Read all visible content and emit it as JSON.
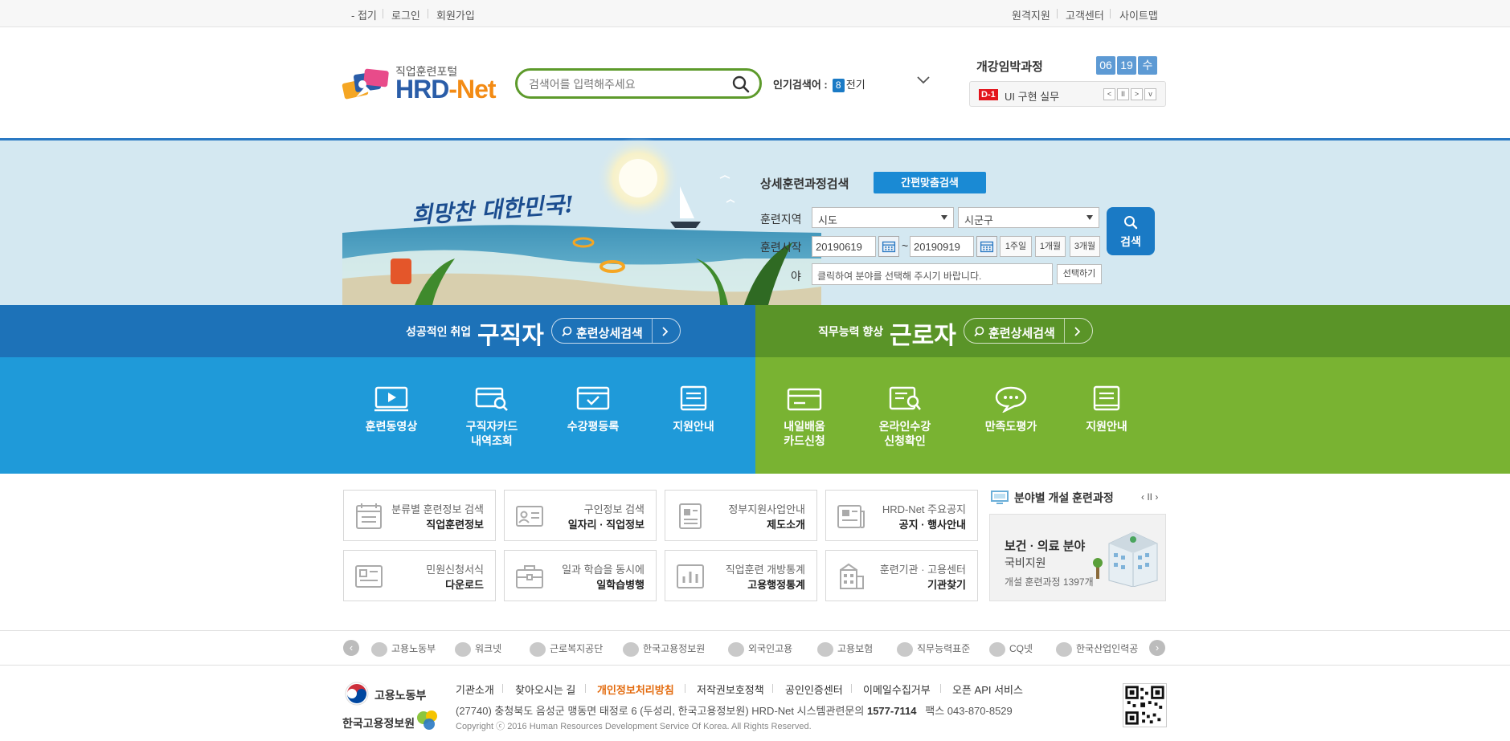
{
  "topbar": {
    "left": [
      "- 접기",
      "로그인",
      "회원가입"
    ],
    "right": [
      "원격지원",
      "고객센터",
      "사이트맵"
    ]
  },
  "header": {
    "logo_small": "직업훈련포털",
    "logo_big_hrd": "HRD",
    "logo_big_net": "-Net",
    "search_placeholder": "검색어를 입력해주세요",
    "popular_label": "인기검색어 :",
    "popular_rank": "8",
    "popular_keyword": "전기"
  },
  "open_course": {
    "title": "개강임박과정",
    "month": "06",
    "day": "19",
    "weekday": "수",
    "dday": "D-1",
    "course": "UI 구현 실무",
    "controls": [
      "<",
      "II",
      ">",
      "v"
    ]
  },
  "hero": {
    "title": "희망찬 대한민국!",
    "detail_search_title": "상세훈련과정검색",
    "quick_search_button": "간편맞춤검색",
    "region_label": "훈련지역",
    "region_select": "시도",
    "district_select": "시군구",
    "start_label": "훈련시작",
    "date_from": "20190619",
    "date_to": "20190919",
    "date_tilde": "~",
    "periods": [
      "1주일",
      "1개월",
      "3개월"
    ],
    "field_label": "야",
    "field_placeholder": "클릭하여 분야를 선택해 주시기 바랍니다.",
    "choose_button": "선택하기",
    "search_button": "검색"
  },
  "seeker": {
    "small": "성공적인 취업",
    "big": "구직자",
    "pill": "훈련상세검색",
    "items": [
      {
        "line1": "훈련동영상",
        "line2": ""
      },
      {
        "line1": "구직자카드",
        "line2": "내역조회"
      },
      {
        "line1": "수강평등록",
        "line2": ""
      },
      {
        "line1": "지원안내",
        "line2": ""
      }
    ]
  },
  "worker": {
    "small": "직무능력 향상",
    "big": "근로자",
    "pill": "훈련상세검색",
    "items": [
      {
        "line1": "내일배움",
        "line2": "카드신청"
      },
      {
        "line1": "온라인수강",
        "line2": "신청확인"
      },
      {
        "line1": "만족도평가",
        "line2": ""
      },
      {
        "line1": "지원안내",
        "line2": ""
      }
    ]
  },
  "info_boxes": [
    {
      "sub": "분류별 훈련정보 검색",
      "main": "직업훈련정보"
    },
    {
      "sub": "구인정보 검색",
      "main": "일자리 · 직업정보"
    },
    {
      "sub": "정부지원사업안내",
      "main": "제도소개"
    },
    {
      "sub": "HRD-Net 주요공지",
      "main": "공지 · 행사안내"
    },
    {
      "sub": "민원신청서식",
      "main": "다운로드"
    },
    {
      "sub": "일과 학습을 동시에",
      "main": "일학습병행"
    },
    {
      "sub": "직업훈련 개방통계",
      "main": "고용행정통계"
    },
    {
      "sub": "훈련기관 · 고용센터",
      "main": "기관찾기"
    }
  ],
  "field_course": {
    "title": "분야별 개설 훈련과정",
    "controls": "‹ II ›",
    "line1": "보건 · 의료 분야",
    "line2": "국비지원",
    "line3": "개설 훈련과정 1397개"
  },
  "partners": [
    "고용노동부",
    "워크넷",
    "근로복지공단",
    "한국고용정보원",
    "외국인고용",
    "고용보험",
    "직무능력표준",
    "CQ넷",
    "한국산업인력공"
  ],
  "footer": {
    "org1": "고용노동부",
    "org2": "한국고용정보원",
    "links": [
      "기관소개",
      "찾아오시는 길",
      "개인정보처리방침",
      "저작권보호정책",
      "공인인증센터",
      "이메일수집거부",
      "오픈 API 서비스"
    ],
    "address": "(27740) 충청북도 음성군 맹동면 태정로 6 (두성리, 한국고용정보원) HRD-Net 시스템관련문의",
    "phone": "1577-7114",
    "fax": "팩스 043-870-8529",
    "copyright": "Copyright ⓒ 2016 Human Resources Development Service Of Korea. All Rights Reserved."
  },
  "colors": {
    "seeker_dark": "#1d72b8",
    "seeker_light": "#1f9ad9",
    "worker_dark": "#5a9428",
    "worker_light": "#79b332",
    "search_border": "#5d9a2b",
    "privacy_link": "#e36a0c"
  }
}
